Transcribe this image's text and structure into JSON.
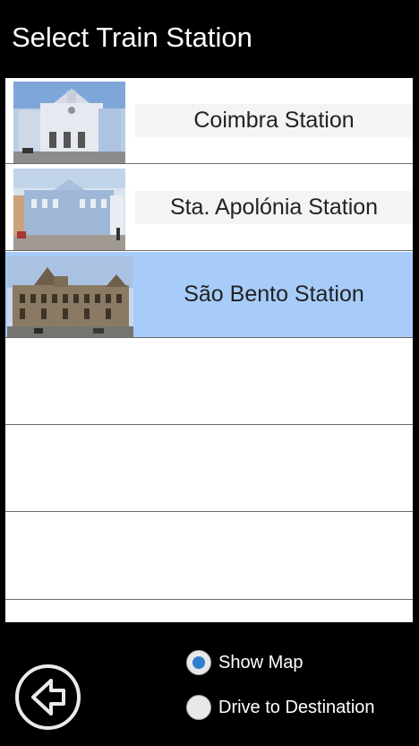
{
  "header": {
    "title": "Select Train Station"
  },
  "stations": [
    {
      "label": "Coimbra Station",
      "selected": false
    },
    {
      "label": "Sta. Apolónia Station",
      "selected": false
    },
    {
      "label": "São Bento Station",
      "selected": true
    }
  ],
  "options": {
    "show_map": {
      "label": "Show Map",
      "checked": true
    },
    "drive": {
      "label": "Drive to Destination",
      "checked": false
    }
  },
  "colors": {
    "selected_row": "#a7ccf9",
    "radio_accent": "#2e7fcb",
    "background": "#000000"
  },
  "icons": {
    "back": "back-arrow-icon"
  }
}
